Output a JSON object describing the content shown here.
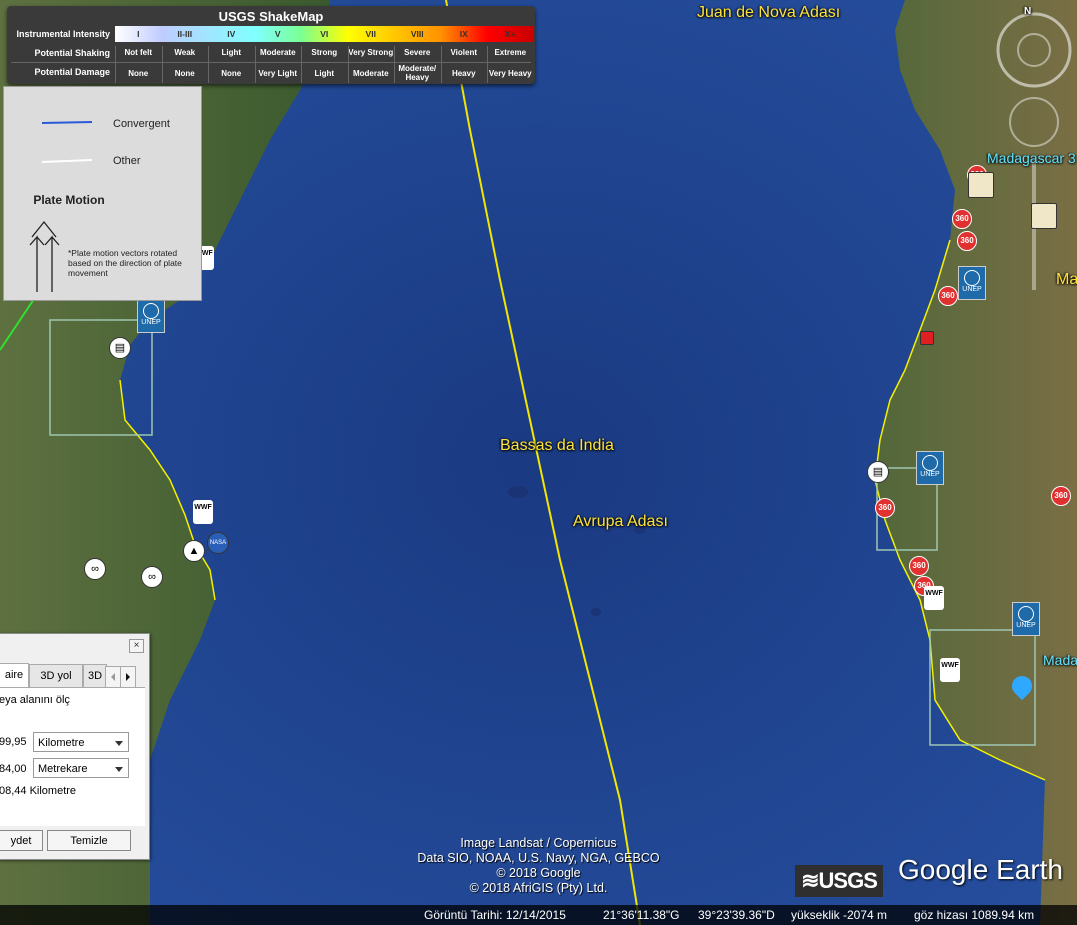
{
  "map": {
    "places": {
      "juan_de_nova": "Juan de Nova Adası",
      "bassas_da_india": "Bassas da India",
      "avrupa": "Avrupa Adası",
      "madagascar_3": "Madagascar 3",
      "ma": "Ma",
      "mada": "Mada"
    },
    "credits": [
      "Image Landsat / Copernicus",
      "Data SIO, NOAA, U.S. Navy, NGA, GEBCO",
      "© 2018 Google",
      "© 2018 AfriGIS (Pty) Ltd."
    ],
    "logos": {
      "usgs": "≋USGS",
      "google_earth": "Google Earth"
    },
    "compass_north": "N",
    "layer_icons": {
      "unep": "UNEP",
      "pano": "360",
      "wwf": "WWF",
      "nasa": "NASA"
    },
    "colors": {
      "ocean": "#1c3f86",
      "plate_boundary": "#f2e600",
      "coast": "#f4f000",
      "land": "#3c5a2c"
    }
  },
  "shakemap": {
    "title": "USGS ShakeMap",
    "row_labels": [
      "Instrumental Intensity",
      "Potential Shaking",
      "Potential Damage"
    ],
    "intensity": [
      "I",
      "II-III",
      "IV",
      "V",
      "VI",
      "VII",
      "VIII",
      "IX",
      "X+"
    ],
    "shaking": [
      "Not felt",
      "Weak",
      "Light",
      "Moderate",
      "Strong",
      "Very Strong",
      "Severe",
      "Violent",
      "Extreme"
    ],
    "damage": [
      "None",
      "None",
      "None",
      "Very Light",
      "Light",
      "Moderate",
      "Moderate/ Heavy",
      "Heavy",
      "Very Heavy"
    ],
    "colors": [
      "#ffffff",
      "#bfccff",
      "#a0e6ff",
      "#80ffff",
      "#7aff93",
      "#ffff00",
      "#ffc800",
      "#ff9100",
      "#ff0000",
      "#c80000"
    ]
  },
  "plate_legend": {
    "convergent": "Convergent",
    "other": "Other",
    "heading": "Plate Motion",
    "note": "*Plate motion vectors rotated based on the direction of plate movement"
  },
  "ruler": {
    "tabs": [
      "aire",
      "3D yol",
      "3D"
    ],
    "hint": "eya alanını ölç",
    "perimeter_value": "99,95",
    "perimeter_unit": "Kilometre",
    "area_value": "84,00",
    "area_unit": "Metrekare",
    "extra": "08,44 Kilometre",
    "save": "ydet",
    "clear": "Temizle",
    "close": "×"
  },
  "status": {
    "date": "Görüntü Tarihi: 12/14/2015",
    "lat": "21°36'11.38\"G",
    "lon": "39°23'39.36\"D",
    "elev": "yükseklik -2074 m",
    "eye": "göz hizası 1089.94 km"
  }
}
